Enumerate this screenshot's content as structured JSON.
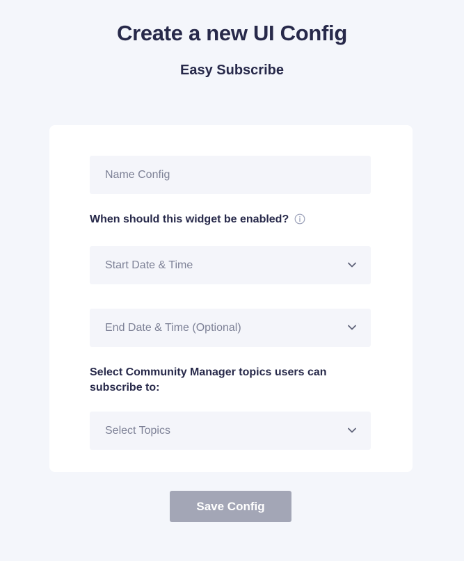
{
  "page": {
    "title": "Create a new UI Config",
    "subtitle": "Easy Subscribe"
  },
  "form": {
    "name_placeholder": "Name Config",
    "enabled_question": "When should this widget be enabled?",
    "start_date_placeholder": "Start Date & Time",
    "end_date_placeholder": "End Date & Time (Optional)",
    "topics_label_line1": "Select Community Manager topics users can",
    "topics_label_line2": "subscribe to:",
    "topics_placeholder": "Select Topics"
  },
  "actions": {
    "save_label": "Save Config"
  },
  "icons": {
    "info": "info-icon",
    "chevron": "chevron-down-icon"
  },
  "colors": {
    "background": "#f4f6fb",
    "card": "#ffffff",
    "field": "#f4f5fa",
    "text_dark": "#27294a",
    "placeholder": "#7d8196",
    "button_disabled": "#a3a6b6"
  }
}
